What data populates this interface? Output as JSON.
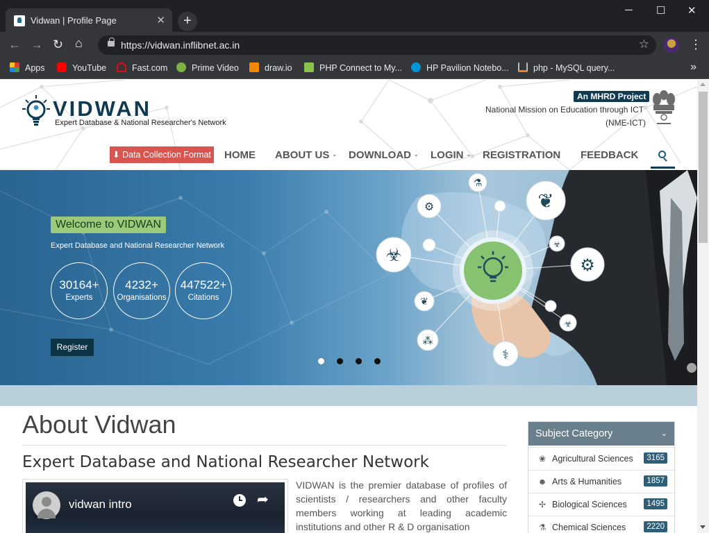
{
  "browser": {
    "tab_title": "Vidwan | Profile Page",
    "url": "https://vidwan.inflibnet.ac.in",
    "bookmarks": [
      {
        "label": "Apps",
        "icon": "apps-grid-icon",
        "color": "#e53935"
      },
      {
        "label": "YouTube",
        "icon": "youtube-icon",
        "color": "#ff0000"
      },
      {
        "label": "Fast.com",
        "icon": "fast-icon",
        "color": "#e50914"
      },
      {
        "label": "Prime Video",
        "icon": "prime-video-icon",
        "color": "#7cb342"
      },
      {
        "label": "draw.io",
        "icon": "drawio-icon",
        "color": "#f08705"
      },
      {
        "label": "PHP Connect to My...",
        "icon": "w3schools-icon",
        "color": "#8bc34a"
      },
      {
        "label": "HP Pavilion Notebo...",
        "icon": "hp-icon",
        "color": "#0096d6"
      },
      {
        "label": "php - MySQL query...",
        "icon": "stackoverflow-icon",
        "color": "#f48024"
      }
    ]
  },
  "header": {
    "logo_text": "VIDWAN",
    "logo_subtitle": "Expert Database & National Researcher's Network",
    "mhrd_badge": "An MHRD Project",
    "mission_line1": "National Mission on Education through ICT",
    "mission_line2": "(NME-ICT)",
    "data_collection_button": "Data Collection Format",
    "nav": [
      {
        "label": "HOME",
        "has_caret": false
      },
      {
        "label": "ABOUT US",
        "has_caret": true
      },
      {
        "label": "DOWNLOAD",
        "has_caret": true
      },
      {
        "label": "LOGIN",
        "has_caret": true
      },
      {
        "label": "REGISTRATION",
        "has_caret": false
      },
      {
        "label": "FEEDBACK",
        "has_caret": false
      }
    ]
  },
  "hero": {
    "welcome": "Welcome to VIDWAN",
    "tagline": "Expert Database and National Researcher Network",
    "stats": [
      {
        "value": "30164+",
        "label": "Experts"
      },
      {
        "value": "4232+",
        "label": "Organisations"
      },
      {
        "value": "447522+",
        "label": "Citations"
      }
    ],
    "register_button": "Register",
    "slides": 4,
    "active_slide": 1
  },
  "about": {
    "title": "About Vidwan",
    "subtitle": "Expert Database and National Researcher Network",
    "video_title": "vidwan intro",
    "text": "VIDWAN is the premier database of profiles of scientists / researchers and other faculty members working at leading academic institutions and other R & D organisation"
  },
  "subject_category": {
    "title": "Subject Category",
    "items": [
      {
        "label": "Agricultural Sciences",
        "count": "3165",
        "icon": "agriculture-icon"
      },
      {
        "label": "Arts & Humanities",
        "count": "1857",
        "icon": "arts-icon"
      },
      {
        "label": "Biological Sciences",
        "count": "1495",
        "icon": "dna-icon"
      },
      {
        "label": "Chemical Sciences",
        "count": "2220",
        "icon": "flask-icon"
      }
    ]
  },
  "colors": {
    "brand_dark": "#0f3a52",
    "data_btn": "#d9534f",
    "welcome_bg": "#9bcb7a",
    "count_badge": "#2f5f78"
  }
}
